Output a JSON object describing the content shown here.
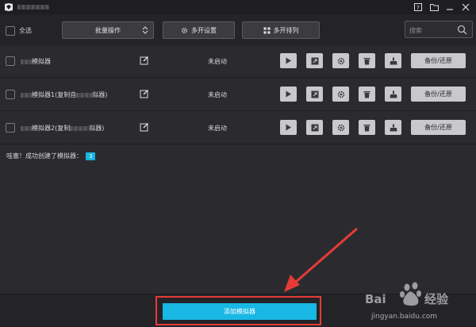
{
  "toolbar": {
    "select_all_label": "全选",
    "batch_label": "批量操作",
    "multi_settings_label": "多开设置",
    "multi_arrange_label": "多开排列",
    "search_placeholder": "搜索"
  },
  "emulators": [
    {
      "name_suffix": "模拟器",
      "status": "未启动",
      "backup_label": "备份/还原"
    },
    {
      "name_suffix": "模拟器1(复制自",
      "name_end": "拟器)",
      "status": "未启动",
      "backup_label": "备份/还原"
    },
    {
      "name_suffix": "模拟器2(复制",
      "name_end": "拟器)",
      "status": "未启动",
      "backup_label": "备份/还原"
    }
  ],
  "message": {
    "text": "哇塞！成功创建了模拟器：",
    "count": "3"
  },
  "footer": {
    "add_label": "添加模拟器"
  },
  "watermark": {
    "text": "jingyan.baidu.com"
  },
  "colors": {
    "accent": "#19b7e4",
    "highlight": "#e53b36",
    "background": "#2b2b2f"
  }
}
